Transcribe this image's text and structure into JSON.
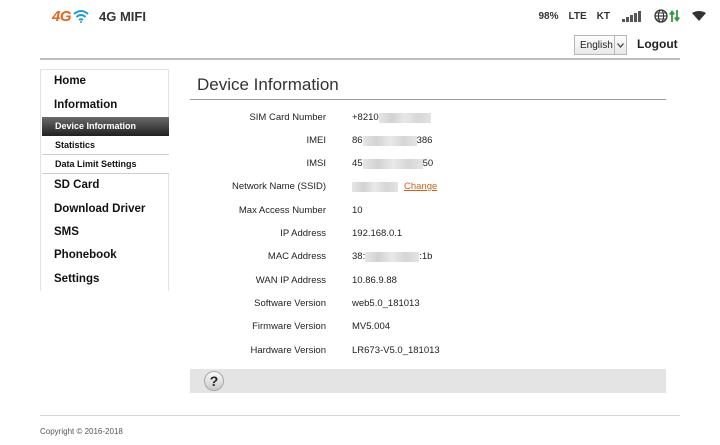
{
  "header": {
    "logo_4g": "4G",
    "logo_name": "4G MIFI",
    "battery": "98%",
    "network_type": "LTE",
    "carrier": "KT",
    "language": "English",
    "logout": "Logout"
  },
  "sidebar": {
    "home": "Home",
    "information": "Information",
    "sub_items": [
      "Device Information",
      "Statistics",
      "Data Limit Settings"
    ],
    "sd_card": "SD Card",
    "download_driver": "Download Driver",
    "sms": "SMS",
    "phonebook": "Phonebook",
    "settings": "Settings"
  },
  "main": {
    "title": "Device Information",
    "rows": [
      {
        "label": "SIM Card Number",
        "value": "+8210"
      },
      {
        "label": "IMEI",
        "value_prefix": "86",
        "value_suffix": "386"
      },
      {
        "label": "IMSI",
        "value_prefix": "45",
        "value_suffix": "50"
      },
      {
        "label": "Network Name (SSID)",
        "link": "Change"
      },
      {
        "label": "Max Access Number",
        "value": "10"
      },
      {
        "label": "IP Address",
        "value": "192.168.0.1"
      },
      {
        "label": "MAC Address",
        "value_prefix": "38:",
        "value_suffix": ":1b"
      },
      {
        "label": "WAN IP Address",
        "value": "10.86.9.88"
      },
      {
        "label": "Software Version",
        "value": "web5.0_181013"
      },
      {
        "label": "Firmware Version",
        "value": "MV5.004"
      },
      {
        "label": "Hardware Version",
        "value": "LR673-V5.0_181013"
      }
    ],
    "help": "?"
  },
  "footer": {
    "copyright": "Copyright © 2016-2018"
  },
  "colors": {
    "accent": "#e8641c",
    "link": "#d0601a",
    "wifi_blue": "#1a9bd7",
    "active_menu_top": "#6a6a6a",
    "active_menu_bottom": "#242424"
  }
}
